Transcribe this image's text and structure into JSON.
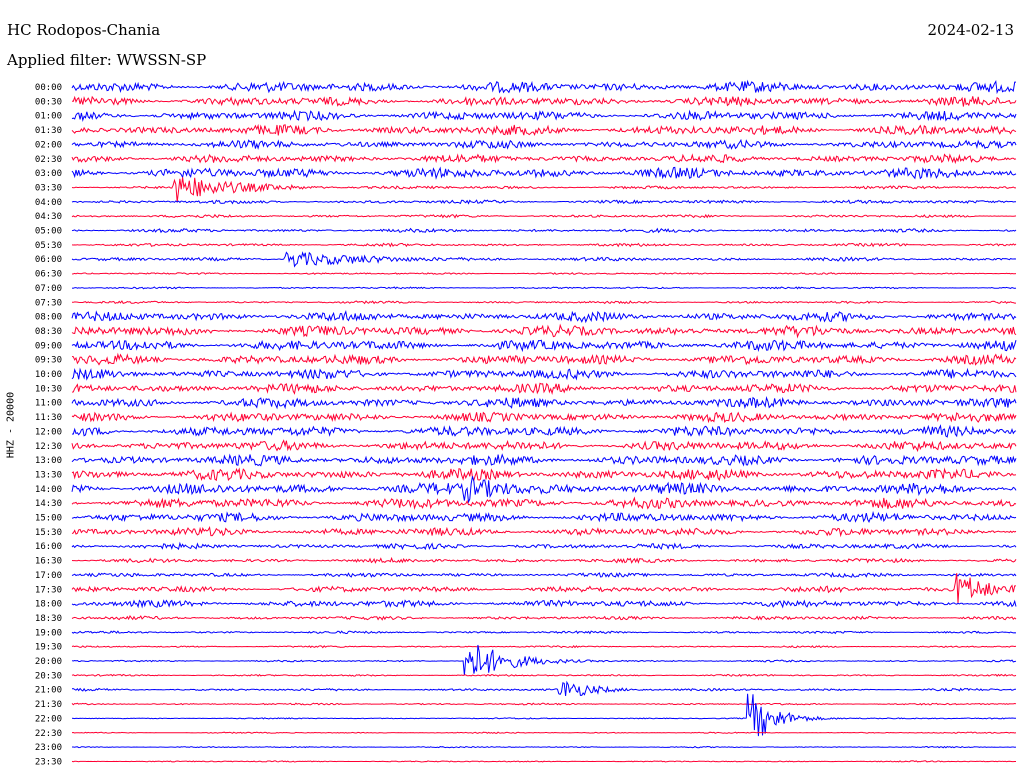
{
  "header": {
    "station": "HC Rodopos-Chania",
    "date": "2024-02-13",
    "filter": "Applied filter: WWSSN-SP"
  },
  "chart_data": {
    "type": "line",
    "ylabel": "HHZ - 20000",
    "colors": [
      "#0000ff",
      "#ff0033"
    ],
    "rows": [
      {
        "label": "00:00",
        "amp": 0.9
      },
      {
        "label": "00:30",
        "amp": 0.8
      },
      {
        "label": "01:00",
        "amp": 0.8
      },
      {
        "label": "01:30",
        "amp": 0.85
      },
      {
        "label": "02:00",
        "amp": 0.7
      },
      {
        "label": "02:30",
        "amp": 0.7
      },
      {
        "label": "03:00",
        "amp": 0.9
      },
      {
        "label": "03:30",
        "amp": 0.25
      },
      {
        "label": "04:00",
        "amp": 0.3
      },
      {
        "label": "04:30",
        "amp": 0.25
      },
      {
        "label": "05:00",
        "amp": 0.3
      },
      {
        "label": "05:30",
        "amp": 0.25
      },
      {
        "label": "06:00",
        "amp": 0.3
      },
      {
        "label": "06:30",
        "amp": 0.15
      },
      {
        "label": "07:00",
        "amp": 0.15
      },
      {
        "label": "07:30",
        "amp": 0.2
      },
      {
        "label": "08:00",
        "amp": 0.8
      },
      {
        "label": "08:30",
        "amp": 0.9
      },
      {
        "label": "09:00",
        "amp": 0.9
      },
      {
        "label": "09:30",
        "amp": 0.85
      },
      {
        "label": "10:00",
        "amp": 0.85
      },
      {
        "label": "10:30",
        "amp": 0.8
      },
      {
        "label": "11:00",
        "amp": 0.85
      },
      {
        "label": "11:30",
        "amp": 0.8
      },
      {
        "label": "12:00",
        "amp": 0.9
      },
      {
        "label": "12:30",
        "amp": 0.85
      },
      {
        "label": "13:00",
        "amp": 0.9
      },
      {
        "label": "13:30",
        "amp": 0.95
      },
      {
        "label": "14:00",
        "amp": 0.95
      },
      {
        "label": "14:30",
        "amp": 0.9
      },
      {
        "label": "15:00",
        "amp": 0.8
      },
      {
        "label": "15:30",
        "amp": 0.7
      },
      {
        "label": "16:00",
        "amp": 0.45
      },
      {
        "label": "16:30",
        "amp": 0.35
      },
      {
        "label": "17:00",
        "amp": 0.35
      },
      {
        "label": "17:30",
        "amp": 0.5
      },
      {
        "label": "18:00",
        "amp": 0.6
      },
      {
        "label": "18:30",
        "amp": 0.3
      },
      {
        "label": "19:00",
        "amp": 0.2
      },
      {
        "label": "19:30",
        "amp": 0.15
      },
      {
        "label": "20:00",
        "amp": 0.15
      },
      {
        "label": "20:30",
        "amp": 0.15
      },
      {
        "label": "21:00",
        "amp": 0.2
      },
      {
        "label": "21:30",
        "amp": 0.15
      },
      {
        "label": "22:00",
        "amp": 0.1
      },
      {
        "label": "22:30",
        "amp": 0.1
      },
      {
        "label": "23:00",
        "amp": 0.1
      },
      {
        "label": "23:30",
        "amp": 0.1
      }
    ],
    "events": [
      {
        "row": 7,
        "x": 0.11,
        "amp": 2.2,
        "width": 0.05
      },
      {
        "row": 40,
        "x": 0.42,
        "amp": 3.5,
        "width": 0.035
      },
      {
        "row": 42,
        "x": 0.52,
        "amp": 1.5,
        "width": 0.03
      },
      {
        "row": 44,
        "x": 0.72,
        "amp": 4.0,
        "width": 0.025
      },
      {
        "row": 35,
        "x": 0.94,
        "amp": 2.5,
        "width": 0.03
      },
      {
        "row": 28,
        "x": 0.42,
        "amp": 1.5,
        "width": 0.04
      },
      {
        "row": 12,
        "x": 0.23,
        "amp": 1.3,
        "width": 0.06
      }
    ]
  }
}
